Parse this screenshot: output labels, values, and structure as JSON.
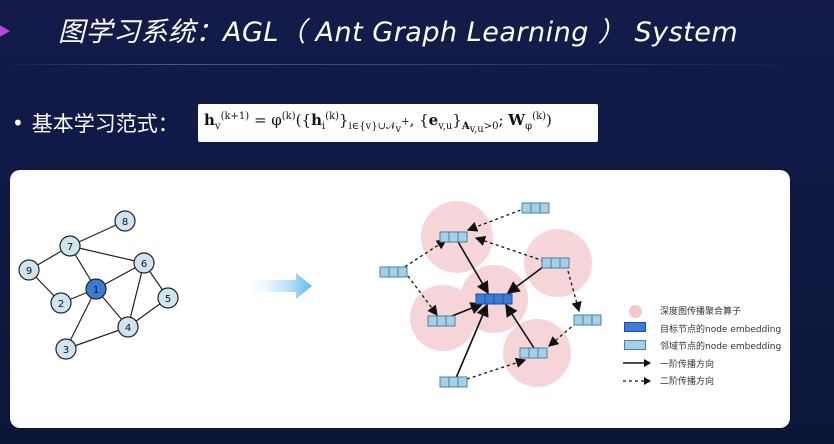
{
  "title": "图学习系统：AGL（ Ant Graph Learning ） System",
  "bullet": {
    "dot": "•",
    "label": "基本学习范式：",
    "formula_text": "h_v^(k+1) = φ^(k)({h_i^(k)}_{i∈{v}∪N_v^+}, {e_{v,u}}_{A_{v,u}>0}; W_φ^(k))"
  },
  "colors": {
    "background": "#141b4a",
    "title_accent": "#b24bd6",
    "target_node": "#3a7bd5",
    "neighbor_node": "#a6cfe8",
    "graph_node": "#cfe3f1",
    "aggregation_circle": "#f4c8cc",
    "arrow_blue": "#5fb7ee"
  },
  "graph": {
    "nodes": [
      "1",
      "2",
      "3",
      "4",
      "5",
      "6",
      "7",
      "8",
      "9"
    ],
    "edges": [
      [
        "7",
        "8"
      ],
      [
        "7",
        "9"
      ],
      [
        "7",
        "1"
      ],
      [
        "7",
        "6"
      ],
      [
        "9",
        "2"
      ],
      [
        "2",
        "1"
      ],
      [
        "1",
        "6"
      ],
      [
        "1",
        "3"
      ],
      [
        "1",
        "4"
      ],
      [
        "6",
        "4"
      ],
      [
        "6",
        "5"
      ],
      [
        "5",
        "4"
      ],
      [
        "4",
        "3"
      ]
    ]
  },
  "legend": {
    "items": [
      {
        "icon": "aggregation-circle-icon",
        "label": "深度图传播聚合算子"
      },
      {
        "icon": "target-node-embedding-icon",
        "label": "目标节点的node embedding"
      },
      {
        "icon": "neighbor-node-embedding-icon",
        "label": "邻域节点的node embedding"
      },
      {
        "icon": "solid-arrow-icon",
        "label": "一阶传播方向"
      },
      {
        "icon": "dashed-arrow-icon",
        "label": "二阶传播方向"
      }
    ]
  }
}
